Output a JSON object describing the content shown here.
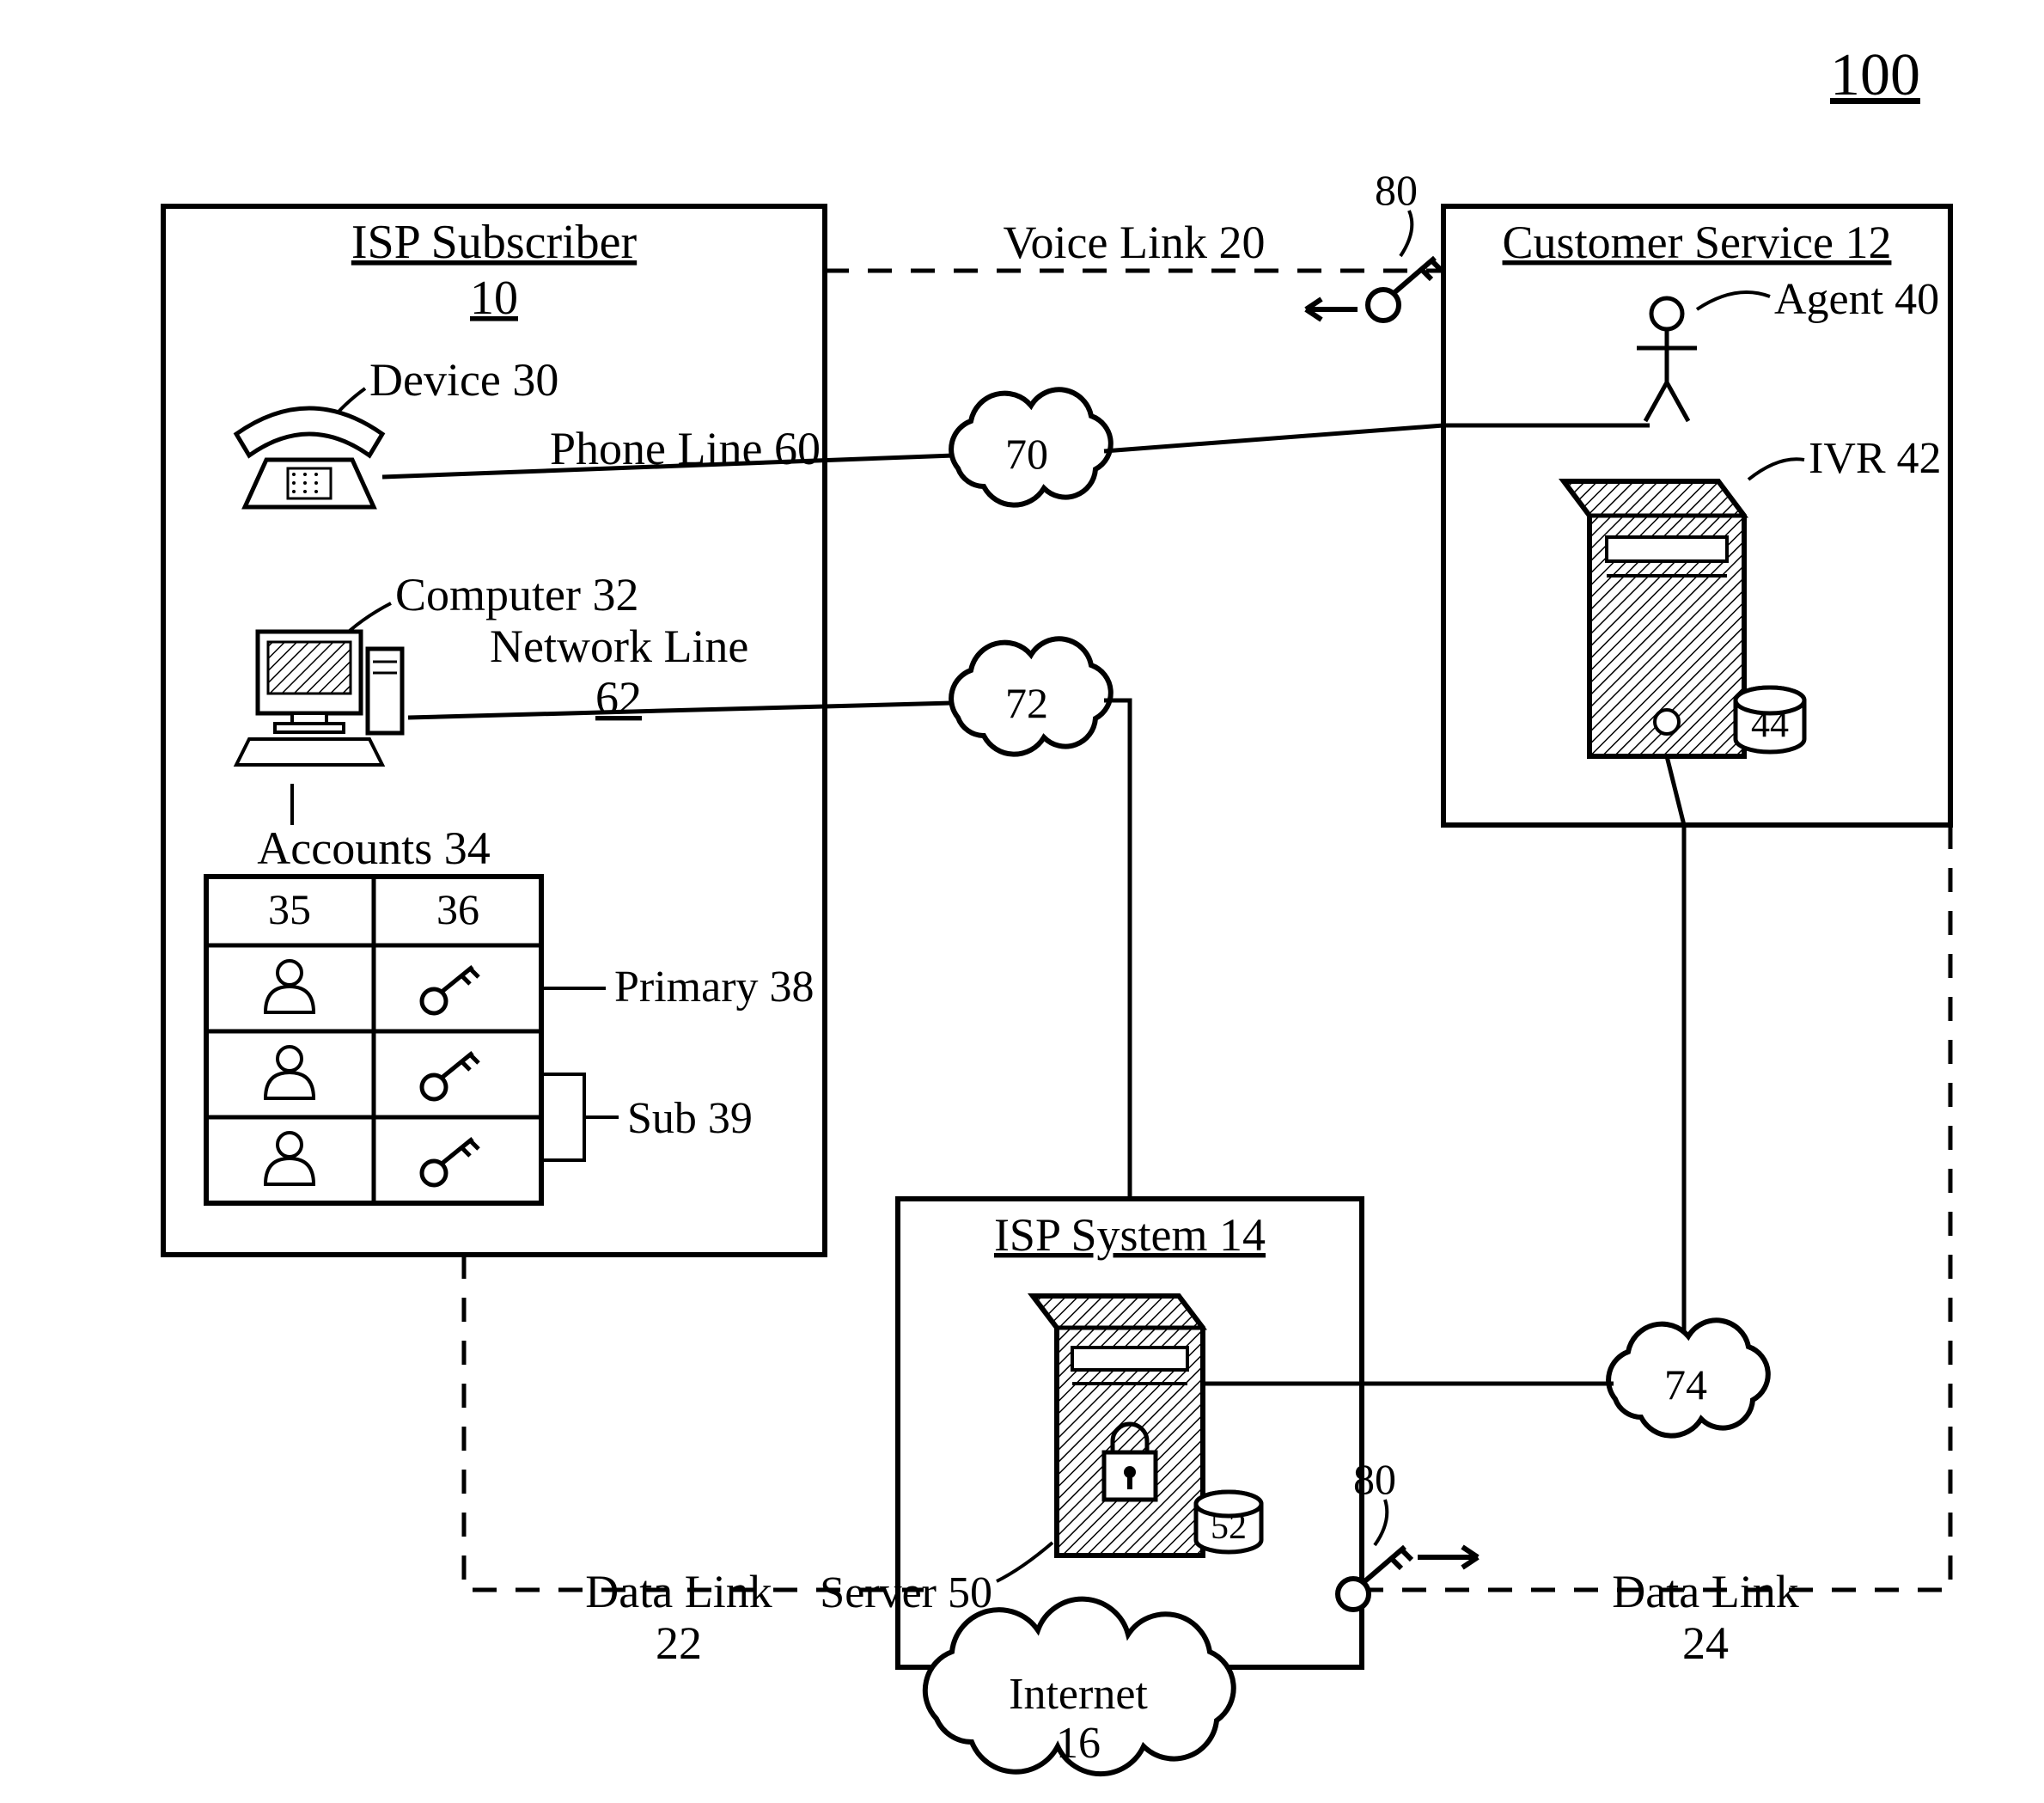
{
  "figure_number": "100",
  "boxes": {
    "subscriber": {
      "title": "ISP Subscriber",
      "number": "10"
    },
    "customer_service": {
      "title": "Customer Service 12"
    },
    "isp_system": {
      "title": "ISP System 14"
    }
  },
  "labels": {
    "voice_link": "Voice Link 20",
    "device": "Device 30",
    "phone_line": "Phone Line 60",
    "computer": "Computer 32",
    "network_line_a": "Network Line",
    "network_line_b": "62",
    "accounts": "Accounts 34",
    "primary": "Primary 38",
    "sub": "Sub 39",
    "agent": "Agent 40",
    "ivr": "IVR 42",
    "server": "Server 50",
    "internet_a": "Internet",
    "internet_b": "16",
    "data_link_left_a": "Data Link",
    "data_link_left_b": "22",
    "data_link_right_a": "Data Link",
    "data_link_right_b": "24",
    "acct_35": "35",
    "acct_36": "36",
    "key80_top": "80",
    "key80_bottom": "80",
    "db44": "44",
    "db52": "52"
  },
  "clouds": {
    "c70": "70",
    "c72": "72",
    "c74": "74"
  }
}
